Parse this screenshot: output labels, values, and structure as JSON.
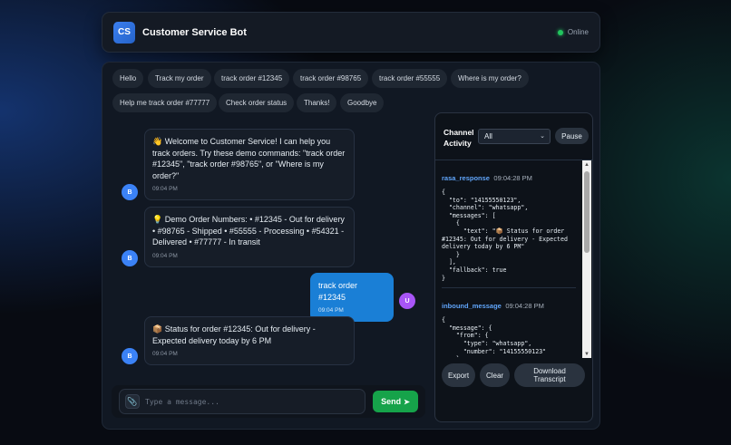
{
  "header": {
    "logo_text": "CS",
    "title": "Customer Service Bot",
    "status": "Online",
    "status_color": "#22c55e"
  },
  "quick_replies": [
    "Hello",
    "Track my order",
    "track order #12345",
    "track order #98765",
    "track order #55555",
    "Where is my order?",
    "Help me track order #77777",
    "Check order status",
    "Thanks!",
    "Goodbye"
  ],
  "messages": [
    {
      "sender": "bot",
      "avatar": "B",
      "text": "👋 Welcome to Customer Service! I can help you track orders. Try these demo commands: \"track order #12345\", \"track order #98765\", or \"Where is my order?\"",
      "time": "09:04 PM"
    },
    {
      "sender": "bot",
      "avatar": "B",
      "text": "💡 Demo Order Numbers: • #12345 - Out for delivery • #98765 - Shipped • #55555 - Processing • #54321 - Delivered • #77777 - In transit",
      "time": "09:04 PM"
    },
    {
      "sender": "user",
      "avatar": "U",
      "text": "track order #12345",
      "time": "09:04 PM"
    },
    {
      "sender": "bot",
      "avatar": "B",
      "text": "📦 Status for order #12345: Out for delivery - Expected delivery today by 6 PM",
      "time": "09:04 PM"
    }
  ],
  "composer": {
    "placeholder": "Type a message...",
    "attach_icon": "📎",
    "send_label": "Send",
    "send_icon": "➤"
  },
  "activity": {
    "title": "Channel Activity",
    "filter_value": "All",
    "pause_label": "Pause",
    "entries": [
      {
        "type": "rasa_response",
        "time": "09:04:28 PM",
        "body": "{\n  \"to\": \"14155550123\",\n  \"channel\": \"whatsapp\",\n  \"messages\": [\n    {\n      \"text\": \"📦 Status for order #12345: Out for delivery - Expected delivery today by 6 PM\"\n    }\n  ],\n  \"fallback\": true\n}"
      },
      {
        "type": "inbound_message",
        "time": "09:04:28 PM",
        "body": "{\n  \"message\": {\n    \"from\": {\n      \"type\": \"whatsapp\",\n      \"number\": \"14155550123\"\n    },\n    \"to\": {\n      \"type\": \"whatsapp\"\n    }\n  }\n}"
      }
    ],
    "export_label": "Export",
    "clear_label": "Clear",
    "download_label": "Download Transcript"
  }
}
